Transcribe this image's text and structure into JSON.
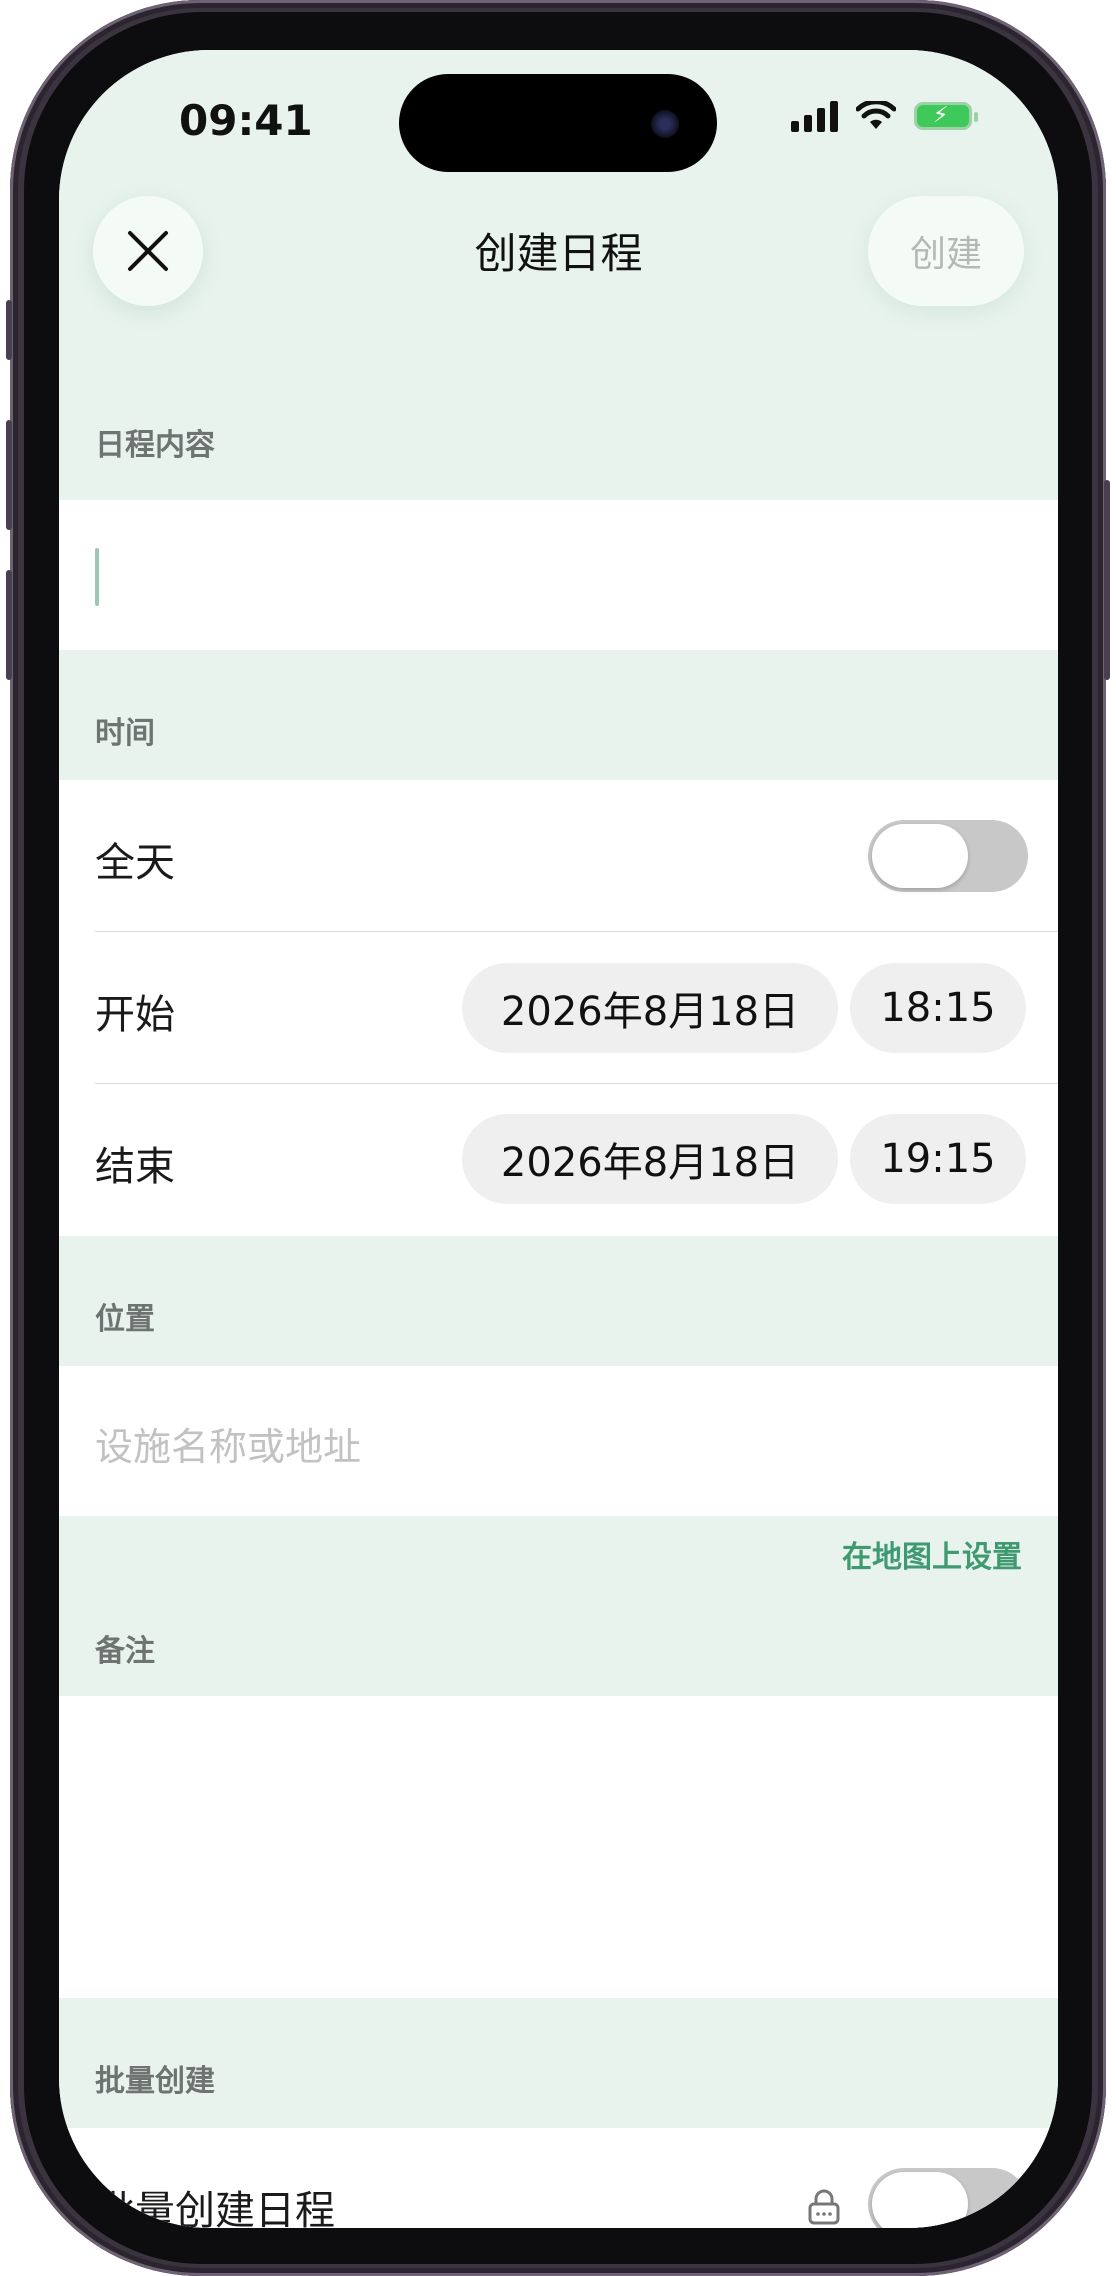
{
  "status_bar": {
    "time": "09:41"
  },
  "nav": {
    "close_icon": "close-icon",
    "title": "创建日程",
    "create_label": "创建"
  },
  "content_section": {
    "header": "日程内容",
    "value": ""
  },
  "time_section": {
    "header": "时间",
    "all_day": {
      "label": "全天",
      "on": false
    },
    "start": {
      "label": "开始",
      "date": "2026年8月18日",
      "time": "18:15"
    },
    "end": {
      "label": "结束",
      "date": "2026年8月18日",
      "time": "19:15"
    }
  },
  "location_section": {
    "header": "位置",
    "placeholder": "设施名称或地址",
    "map_link": "在地图上设置"
  },
  "notes_section": {
    "header": "备注",
    "value": ""
  },
  "batch_section": {
    "header": "批量创建",
    "toggle_label": "批量创建日程",
    "locked": true,
    "on": false
  },
  "colors": {
    "section_bg": "#e8f3ee",
    "accent": "#3f9a72",
    "toggle_off": "#c8c8c8"
  }
}
